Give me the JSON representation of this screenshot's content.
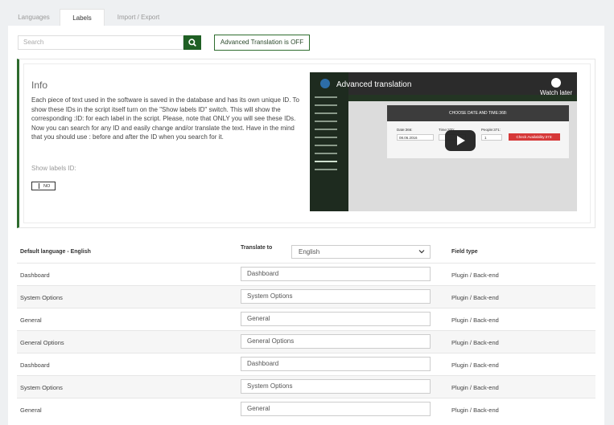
{
  "tabs": [
    {
      "label": "Languages",
      "active": false
    },
    {
      "label": "Labels",
      "active": true
    },
    {
      "label": "Import / Export",
      "active": false
    }
  ],
  "search": {
    "placeholder": "Search",
    "icon": "search-icon"
  },
  "advanced_button": "Advanced Translation is OFF",
  "info": {
    "title": "Info",
    "text": "Each piece of text used in the software is saved in the database and has its own unique ID. To show these IDs in the script itself turn on the \"Show labels ID\" switch. This will show the corresponding :ID: for each label in the script. Please, note that ONLY you will see these IDs. Now you can search for any ID and easily change and/or translate the text. Have in the mind that you should use : before and after the ID when you search for it.",
    "show_labels_label": "Show labels ID:",
    "toggle_text": "NO"
  },
  "video": {
    "title": "Advanced translation",
    "watch_later": "Watch later",
    "card_heading": "CHOOSE DATE AND TIME:368:",
    "date_label": "Date:366:",
    "date_value": "08.06.2016",
    "time_label": "Time:370:",
    "people_label": "People:371:",
    "people_value": "1",
    "button": "Check Availability:373:"
  },
  "table": {
    "headers": {
      "default_language": "Default language - English",
      "translate_to": "Translate to",
      "field_type": "Field type"
    },
    "selected_language": "English",
    "rows": [
      {
        "label": "Dashboard",
        "value": "Dashboard",
        "type": "Plugin / Back-end"
      },
      {
        "label": "System Options",
        "value": "System Options",
        "type": "Plugin / Back-end"
      },
      {
        "label": "General",
        "value": "General",
        "type": "Plugin / Back-end"
      },
      {
        "label": "General Options",
        "value": "General Options",
        "type": "Plugin / Back-end"
      },
      {
        "label": "Dashboard",
        "value": "Dashboard",
        "type": "Plugin / Back-end"
      },
      {
        "label": "System Options",
        "value": "System Options",
        "type": "Plugin / Back-end"
      },
      {
        "label": "General",
        "value": "General",
        "type": "Plugin / Back-end"
      }
    ]
  },
  "colors": {
    "accent": "#1f5f24",
    "info_border": "#2e6b2e",
    "play_button": "#212121"
  }
}
